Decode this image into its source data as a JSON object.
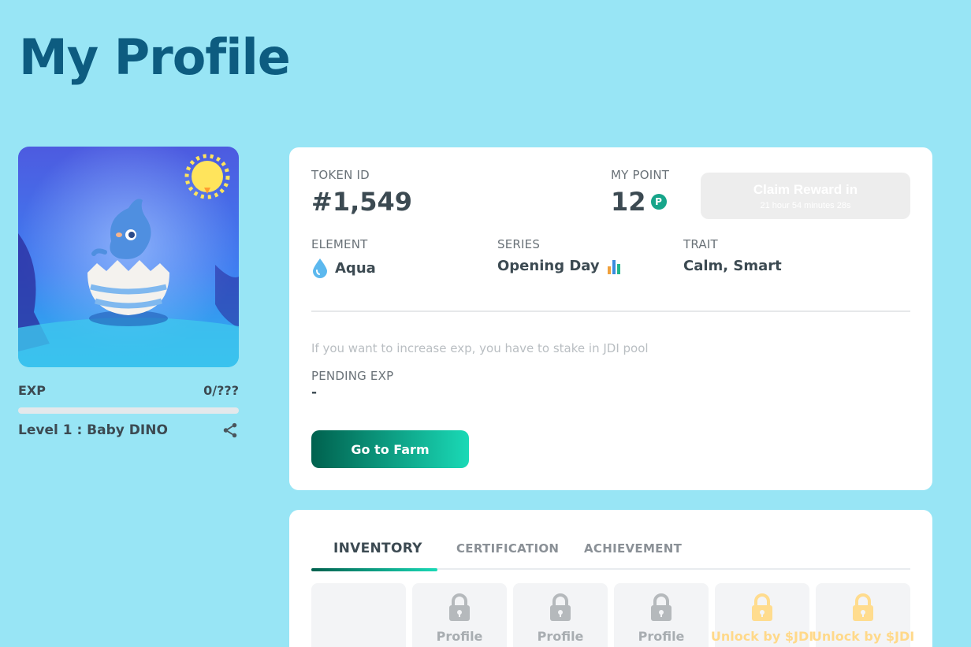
{
  "page": {
    "title": "My Profile"
  },
  "profile": {
    "exp_label": "EXP",
    "exp_value": "0/???",
    "exp_progress": 0,
    "level_text": "Level 1 : Baby DINO"
  },
  "info": {
    "token_label": "TOKEN ID",
    "token_value": "#1,549",
    "point_label": "MY POINT",
    "point_value": "12",
    "point_badge": "P",
    "claim_title": "Claim Reward in",
    "claim_countdown": "21 hour 54 minutes 28s",
    "element_label": "ELEMENT",
    "element_value": "Aqua",
    "series_label": "SERIES",
    "series_value": "Opening Day",
    "trait_label": "TRAIT",
    "trait_value": "Calm, Smart",
    "hint": "If you want to increase exp, you have to stake in JDI pool",
    "pending_label": "PENDING EXP",
    "pending_value": "-",
    "farm_button": "Go to Farm"
  },
  "inventory": {
    "tabs": [
      "INVENTORY",
      "CERTIFICATION",
      "ACHIEVEMENT"
    ],
    "active_tab": "INVENTORY",
    "slots": [
      {
        "label": "",
        "locked": false
      },
      {
        "label": "Profile",
        "locked": true,
        "icon": "lock-icon"
      },
      {
        "label": "Profile",
        "locked": true,
        "icon": "lock-icon"
      },
      {
        "label": "Profile",
        "locked": true,
        "icon": "lock-icon"
      },
      {
        "label": "Unlock by $JDI",
        "locked": true,
        "icon": "lock-icon"
      },
      {
        "label": "Unlock by $JDI",
        "locked": true,
        "icon": "lock-icon"
      }
    ]
  },
  "colors": {
    "background": "#98e5f5",
    "title": "#0d5c80",
    "accent_dark": "#00614e",
    "accent_light": "#1ad9b6",
    "locked_gold": "#ffd98a"
  }
}
